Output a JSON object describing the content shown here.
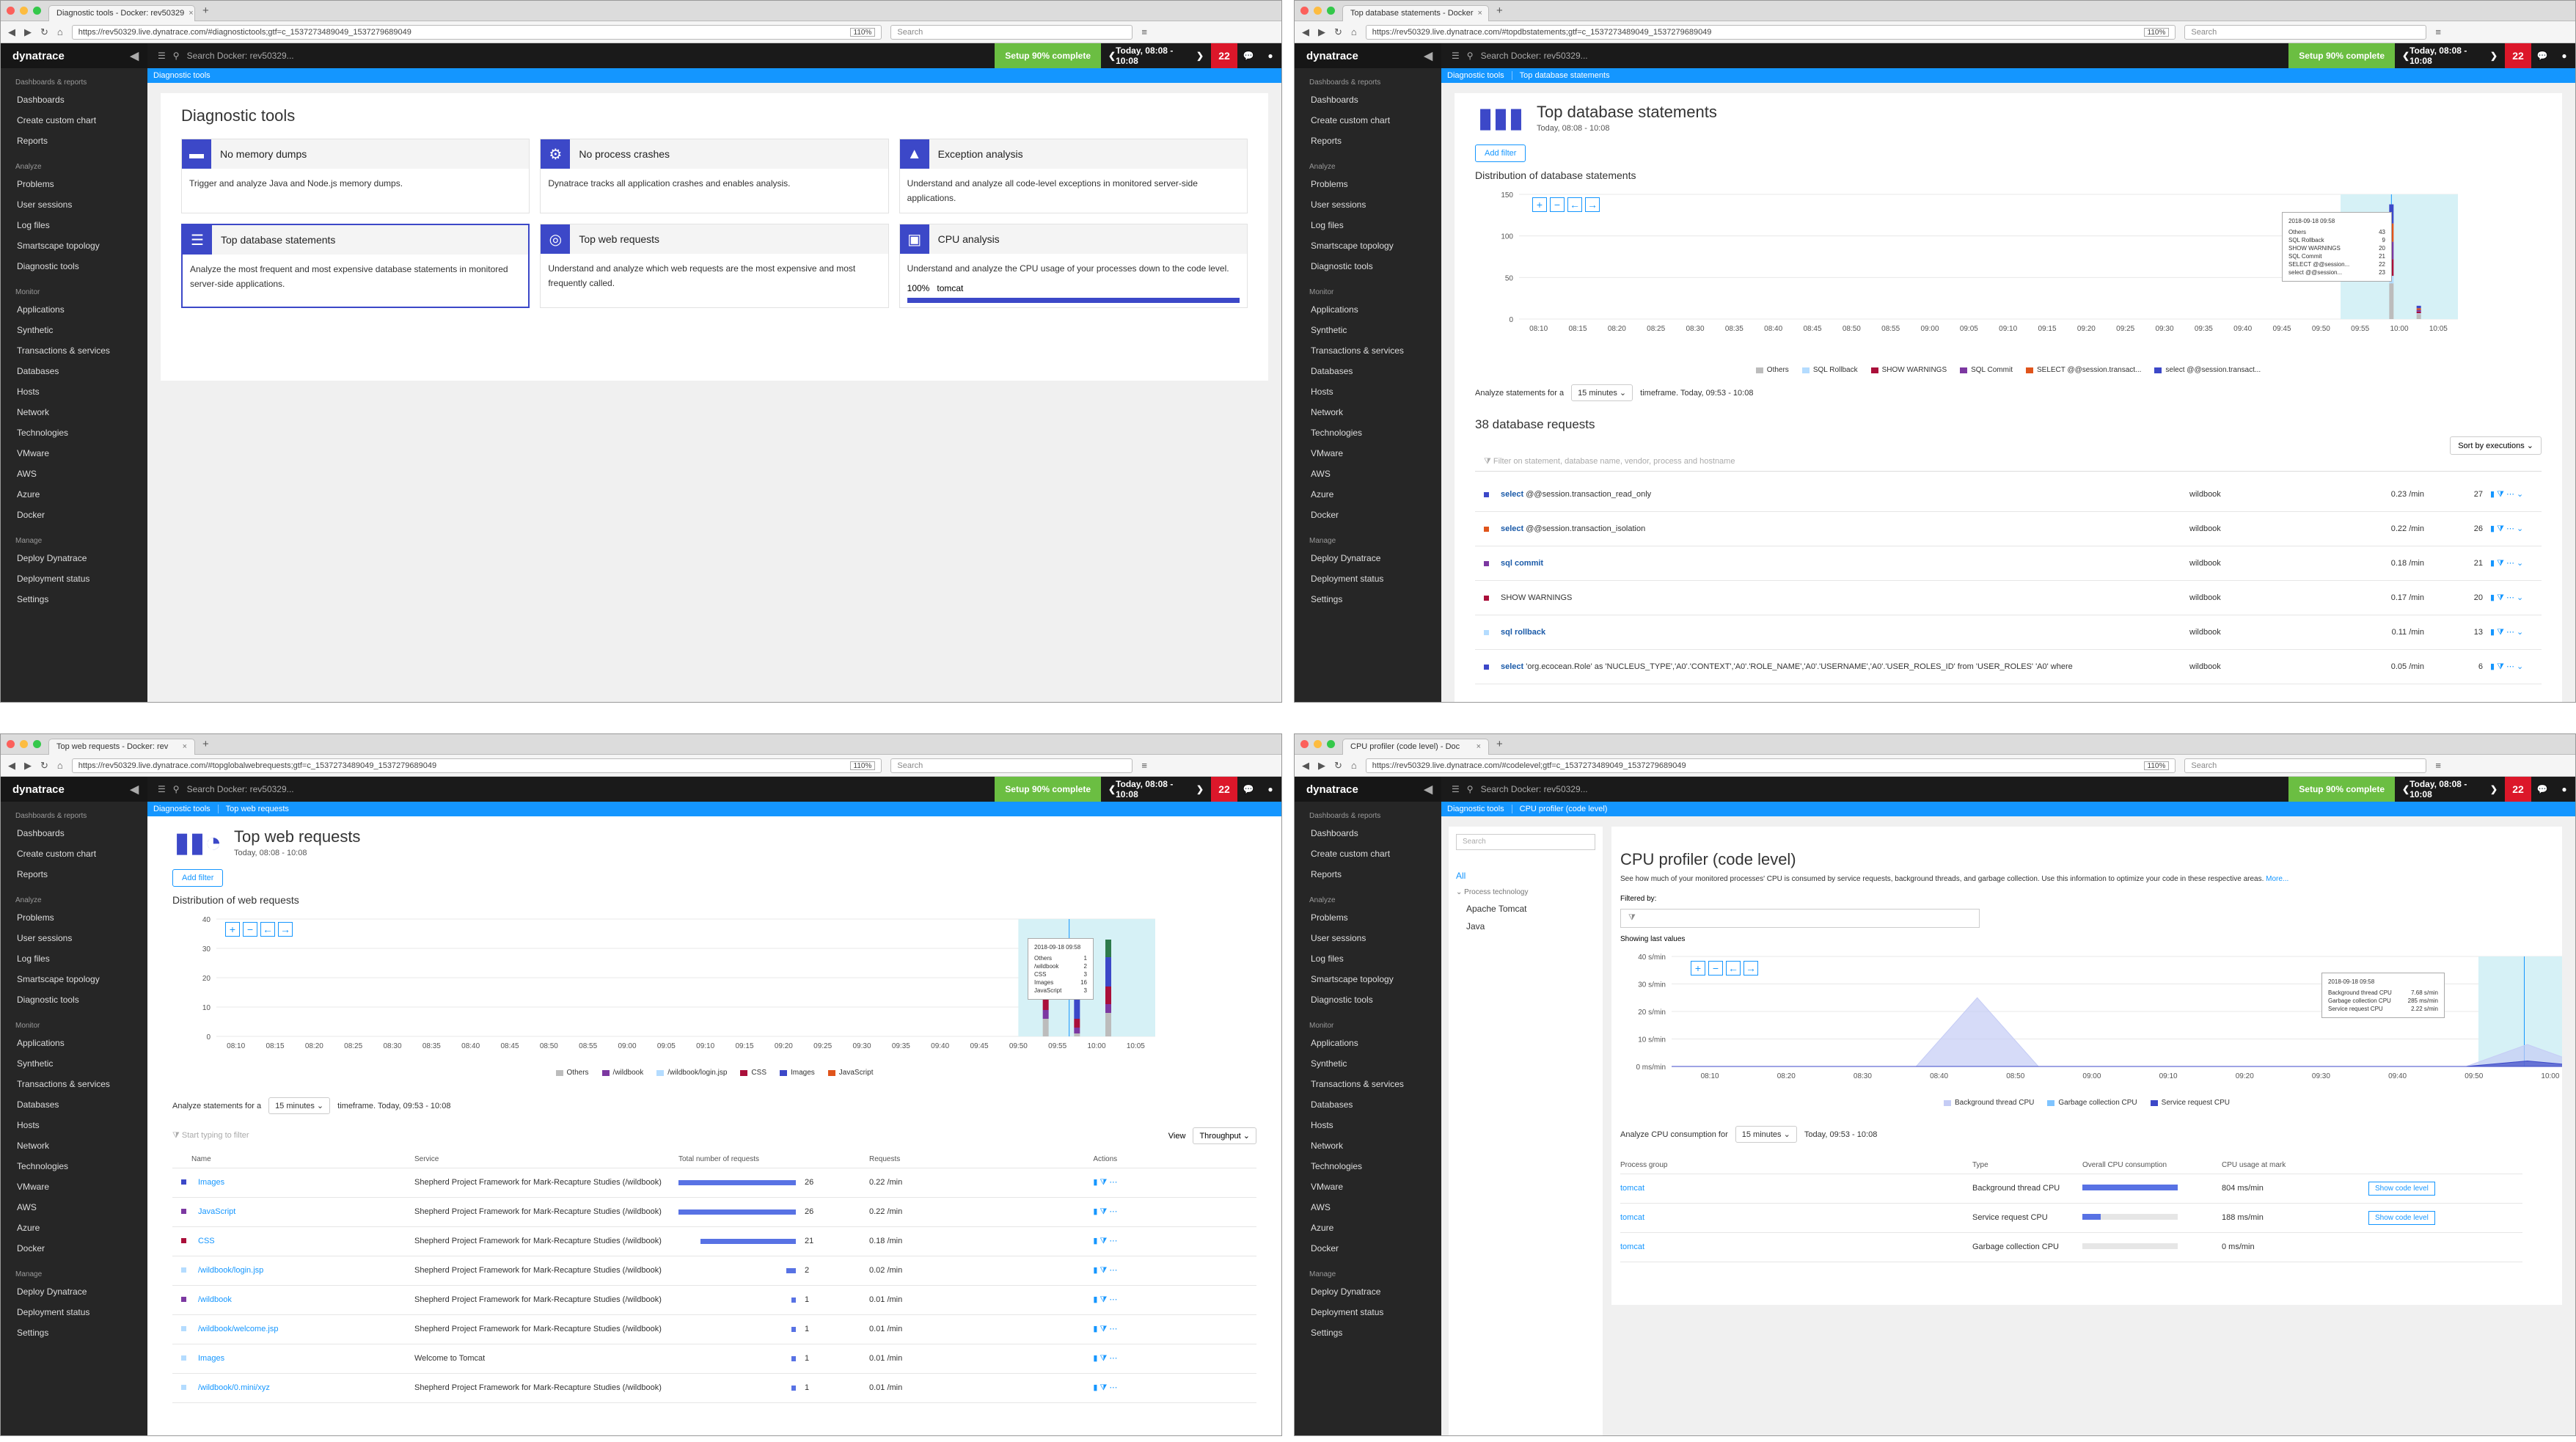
{
  "browser": {
    "windows": [
      {
        "tab_title": "Diagnostic tools - Docker: rev50329",
        "url": "https://rev50329.live.dynatrace.com/#diagnostictools;gtf=c_1537273489049_1537279689049",
        "zoom": "110%",
        "search_placeholder": "Search",
        "status_url": "https://rev50329.live.dynatrace.com/#topdbstatements"
      },
      {
        "tab_title": "Top database statements - Docker",
        "url": "https://rev50329.live.dynatrace.com/#topdbstatements;gtf=c_1537273489049_1537279689049",
        "zoom": "110%",
        "search_placeholder": "Search"
      },
      {
        "tab_title": "Top web requests - Docker: rev",
        "url": "https://rev50329.live.dynatrace.com/#topglobalwebrequests;gtf=c_1537273489049_1537279689049",
        "zoom": "110%",
        "search_placeholder": "Search",
        "status_url": "https://rev50329.live.dynatrace.com/#topdbstatements"
      },
      {
        "tab_title": "CPU profiler (code level) - Doc",
        "url": "https://rev50329.live.dynatrace.com/#codelevel;gtf=c_1537273489049_1537279689049",
        "zoom": "110%",
        "search_placeholder": "Search"
      }
    ]
  },
  "app": {
    "logo": "dynatrace",
    "search": "Search Docker: rev50329...",
    "setup": "Setup 90% complete",
    "timeframe": "Today, 08:08 - 10:08",
    "problems": "22"
  },
  "sidebar": {
    "sections": [
      {
        "header": "Dashboards & reports",
        "items": [
          "Dashboards",
          "Create custom chart",
          "Reports"
        ]
      },
      {
        "header": "Analyze",
        "items": [
          "Problems",
          "User sessions",
          "Log files",
          "Smartscape topology",
          "Diagnostic tools"
        ]
      },
      {
        "header": "Monitor",
        "items": [
          "Applications",
          "Synthetic",
          "Transactions & services",
          "Databases",
          "Hosts",
          "Network",
          "Technologies",
          "VMware",
          "AWS",
          "Azure",
          "Docker"
        ]
      },
      {
        "header": "Manage",
        "items": [
          "Deploy Dynatrace",
          "Deployment status",
          "Settings"
        ]
      }
    ]
  },
  "diag": {
    "crumb": "Diagnostic tools",
    "title": "Diagnostic tools",
    "tools": [
      {
        "name": "No memory dumps",
        "desc": "Trigger and analyze Java and Node.js memory dumps.",
        "icon": "memory-icon"
      },
      {
        "name": "No process crashes",
        "desc": "Dynatrace tracks all application crashes and enables analysis.",
        "icon": "crash-icon"
      },
      {
        "name": "Exception analysis",
        "desc": "Understand and analyze all code-level exceptions in monitored server-side applications.",
        "icon": "warning-icon"
      },
      {
        "name": "Top database statements",
        "desc": "Analyze the most frequent and most expensive database statements in monitored server-side applications.",
        "icon": "database-icon"
      },
      {
        "name": "Top web requests",
        "desc": "Understand and analyze which web requests are the most expensive and most frequently called.",
        "icon": "globe-icon"
      },
      {
        "name": "CPU analysis",
        "desc": "Understand and analyze the CPU usage of your processes down to the code level.",
        "icon": "cpu-icon",
        "pct": "100%",
        "proc": "tomcat"
      }
    ]
  },
  "db": {
    "crumb1": "Diagnostic tools",
    "crumb2": "Top database statements",
    "title": "Top database statements",
    "subtitle": "Today, 08:08 - 10:08",
    "add_filter": "Add filter",
    "dist": "Distribution of database statements",
    "analyze_label": "Analyze statements for a",
    "window": "15 minutes",
    "timeframe_label": "timeframe. Today, 09:53 - 10:08",
    "count_title": "38 database requests",
    "sort": "Sort by executions",
    "filter_ph": "Filter on statement, database name, vendor, process and hostname",
    "legend": [
      "Others",
      "SQL Rollback",
      "SHOW WARNINGS",
      "SQL Commit",
      "SELECT @@session.transact...",
      "select @@session.transact..."
    ],
    "tooltip": {
      "title": "2018-09-18 09:58",
      "rows": [
        [
          "Others",
          "43"
        ],
        [
          "SQL Rollback",
          "9"
        ],
        [
          "SHOW WARNINGS",
          "20"
        ],
        [
          "SQL Commit",
          "21"
        ],
        [
          "SELECT @@session...",
          "22"
        ],
        [
          "select @@session...",
          "23"
        ]
      ]
    },
    "rows": [
      {
        "kw": "select",
        "rest": " @@session.transaction_read_only",
        "svc": "wildbook",
        "rate": "0.23 /min",
        "cnt": "27",
        "color": "#3c48c8"
      },
      {
        "kw": "select",
        "rest": " @@session.transaction_isolation",
        "svc": "wildbook",
        "rate": "0.22 /min",
        "cnt": "26",
        "color": "#e0541b"
      },
      {
        "kw": "sql commit",
        "rest": "",
        "svc": "wildbook",
        "rate": "0.18 /min",
        "cnt": "21",
        "color": "#7c38a1"
      },
      {
        "kw": "",
        "rest": "SHOW WARNINGS",
        "svc": "wildbook",
        "rate": "0.17 /min",
        "cnt": "20",
        "color": "#aa0f3a"
      },
      {
        "kw": "sql rollback",
        "rest": "",
        "svc": "wildbook",
        "rate": "0.11 /min",
        "cnt": "13",
        "color": "#b4dcff"
      },
      {
        "kw": "select",
        "rest": " 'org.ecocean.Role' as 'NUCLEUS_TYPE','A0'.'CONTEXT','A0'.'ROLE_NAME','A0'.'USERNAME','A0'.'USER_ROLES_ID' from 'USER_ROLES' 'A0' where",
        "svc": "wildbook",
        "rate": "0.05 /min",
        "cnt": "6",
        "color": "#3c48c8"
      }
    ],
    "xticks": [
      "08:10",
      "08:15",
      "08:20",
      "08:25",
      "08:30",
      "08:35",
      "08:40",
      "08:45",
      "08:50",
      "08:55",
      "09:00",
      "09:05",
      "09:10",
      "09:15",
      "09:20",
      "09:25",
      "09:30",
      "09:35",
      "09:40",
      "09:45",
      "09:50",
      "09:55",
      "10:00",
      "10:05"
    ],
    "yticks": [
      "150",
      "100",
      "50",
      "0"
    ]
  },
  "web": {
    "crumb1": "Diagnostic tools",
    "crumb2": "Top web requests",
    "title": "Top web requests",
    "subtitle": "Today, 08:08 - 10:08",
    "add_filter": "Add filter",
    "dist": "Distribution of web requests",
    "analyze_label": "Analyze statements for a",
    "window": "15 minutes",
    "timeframe_label": "timeframe. Today, 09:53 - 10:08",
    "filter_ph": "Start typing to filter",
    "view_label": "View",
    "view": "Throughput",
    "legend": [
      "Others",
      "/wildbook",
      "/wildbook/login.jsp",
      "CSS",
      "Images",
      "JavaScript"
    ],
    "tooltip": {
      "title": "2018-09-18 09:58",
      "rows": [
        [
          "Others",
          "1"
        ],
        [
          "/wildbook",
          "2"
        ],
        [
          "CSS",
          "3"
        ],
        [
          "Images",
          "16"
        ],
        [
          "JavaScript",
          "3"
        ]
      ]
    },
    "cols": [
      "Name",
      "Service",
      "Total number of requests",
      "Requests",
      "Actions"
    ],
    "rows": [
      {
        "name": "Images",
        "svc": "Shepherd Project Framework for Mark-Recapture Studies (/wildbook)",
        "total": "26",
        "pct": 1.0,
        "req": "0.22 /min",
        "color": "#3c48c8"
      },
      {
        "name": "JavaScript",
        "svc": "Shepherd Project Framework for Mark-Recapture Studies (/wildbook)",
        "total": "26",
        "pct": 1.0,
        "req": "0.22 /min",
        "color": "#7c38a1"
      },
      {
        "name": "CSS",
        "svc": "Shepherd Project Framework for Mark-Recapture Studies (/wildbook)",
        "total": "21",
        "pct": 0.81,
        "req": "0.18 /min",
        "color": "#aa0f3a"
      },
      {
        "name": "/wildbook/login.jsp",
        "svc": "Shepherd Project Framework for Mark-Recapture Studies (/wildbook)",
        "total": "2",
        "pct": 0.08,
        "req": "0.02 /min",
        "color": "#b4dcff"
      },
      {
        "name": "/wildbook",
        "svc": "Shepherd Project Framework for Mark-Recapture Studies (/wildbook)",
        "total": "1",
        "pct": 0.04,
        "req": "0.01 /min",
        "color": "#7c38a1"
      },
      {
        "name": "/wildbook/welcome.jsp",
        "svc": "Shepherd Project Framework for Mark-Recapture Studies (/wildbook)",
        "total": "1",
        "pct": 0.04,
        "req": "0.01 /min",
        "color": "#b4dcff"
      },
      {
        "name": "Images",
        "svc": "Welcome to Tomcat",
        "total": "1",
        "pct": 0.04,
        "req": "0.01 /min",
        "color": "#b4dcff"
      },
      {
        "name": "/wildbook/0.mini/xyz",
        "svc": "Shepherd Project Framework for Mark-Recapture Studies (/wildbook)",
        "total": "1",
        "pct": 0.04,
        "req": "0.01 /min",
        "color": "#b4dcff"
      }
    ],
    "yticks": [
      "40",
      "30",
      "20",
      "10",
      "0"
    ]
  },
  "cpu": {
    "crumb1": "Diagnostic tools",
    "crumb2": "CPU profiler (code level)",
    "search_ph": "Search",
    "left": {
      "all": "All",
      "group": "Process technology",
      "items": [
        "Apache Tomcat",
        "Java"
      ]
    },
    "title": "CPU profiler (code level)",
    "desc": "See how much of your monitored processes' CPU is consumed by service requests, background threads, and garbage collection. Use this information to optimize your code in these respective areas.",
    "more": "More...",
    "filtered_by": "Filtered by:",
    "showing": "Showing last values",
    "yticks": [
      "40 s/min",
      "30 s/min",
      "20 s/min",
      "10 s/min",
      "0 ms/min"
    ],
    "xticks": [
      "08:10",
      "08:20",
      "08:30",
      "08:40",
      "08:50",
      "09:00",
      "09:10",
      "09:20",
      "09:30",
      "09:40",
      "09:50",
      "10:00"
    ],
    "legend": [
      "Background thread CPU",
      "Garbage collection CPU",
      "Service request CPU"
    ],
    "tooltip": {
      "title": "2018-09-18 09:58",
      "rows": [
        [
          "Background thread CPU",
          "7.68 s/min"
        ],
        [
          "Garbage collection CPU",
          "285 ms/min"
        ],
        [
          "Service request CPU",
          "2.22 s/min"
        ]
      ]
    },
    "analyze_label": "Analyze CPU consumption for",
    "window": "15 minutes",
    "timeframe_label": "Today, 09:53 - 10:08",
    "cols": [
      "Process group",
      "Type",
      "Overall CPU consumption",
      "CPU usage at mark"
    ],
    "rows": [
      {
        "pg": "tomcat",
        "type": "Background thread CPU",
        "frac": 1.0,
        "usage": "804 ms/min",
        "btn": "Show code level"
      },
      {
        "pg": "tomcat",
        "type": "Service request CPU",
        "frac": 0.19,
        "usage": "188 ms/min",
        "btn": "Show code level"
      },
      {
        "pg": "tomcat",
        "type": "Garbage collection CPU",
        "frac": 0.0,
        "usage": "0 ms/min",
        "btn": ""
      }
    ]
  },
  "chart_data": [
    {
      "type": "bar",
      "title": "Distribution of database statements",
      "ylim": [
        0,
        150
      ],
      "x": [
        "09:55",
        "10:00",
        "10:05"
      ],
      "series": [
        {
          "name": "Others",
          "values": [
            0,
            43,
            6
          ]
        },
        {
          "name": "SQL Rollback",
          "values": [
            0,
            9,
            1
          ]
        },
        {
          "name": "SHOW WARNINGS",
          "values": [
            0,
            20,
            2
          ]
        },
        {
          "name": "SQL Commit",
          "values": [
            0,
            21,
            2
          ]
        },
        {
          "name": "SELECT @@session.transact...",
          "values": [
            0,
            22,
            2
          ]
        },
        {
          "name": "select @@session.transact...",
          "values": [
            0,
            23,
            3
          ]
        }
      ]
    },
    {
      "type": "bar",
      "title": "Distribution of web requests",
      "ylim": [
        0,
        40
      ],
      "x": [
        "09:55",
        "10:00",
        "10:05"
      ],
      "series": [
        {
          "name": "Others",
          "values": [
            6,
            1,
            8
          ]
        },
        {
          "name": "/wildbook",
          "values": [
            3,
            2,
            3
          ]
        },
        {
          "name": "CSS",
          "values": [
            5,
            3,
            6
          ]
        },
        {
          "name": "Images",
          "values": [
            8,
            16,
            10
          ]
        },
        {
          "name": "JavaScript",
          "values": [
            5,
            3,
            6
          ]
        }
      ]
    },
    {
      "type": "area",
      "ylim": [
        0,
        40
      ],
      "series": [
        {
          "name": "Background thread CPU",
          "values": [
            0,
            0,
            0,
            0,
            0,
            25,
            0,
            0,
            0,
            0,
            0,
            0,
            0,
            0,
            8,
            0
          ]
        },
        {
          "name": "Garbage collection CPU",
          "values": [
            0,
            0,
            0,
            0,
            0,
            0,
            0,
            0,
            0,
            0,
            0,
            0,
            0,
            0,
            0,
            0
          ]
        },
        {
          "name": "Service request CPU",
          "values": [
            0,
            0,
            0,
            0,
            0,
            0,
            0,
            0,
            0,
            0,
            0,
            0,
            0,
            0,
            2,
            0
          ]
        }
      ]
    }
  ]
}
